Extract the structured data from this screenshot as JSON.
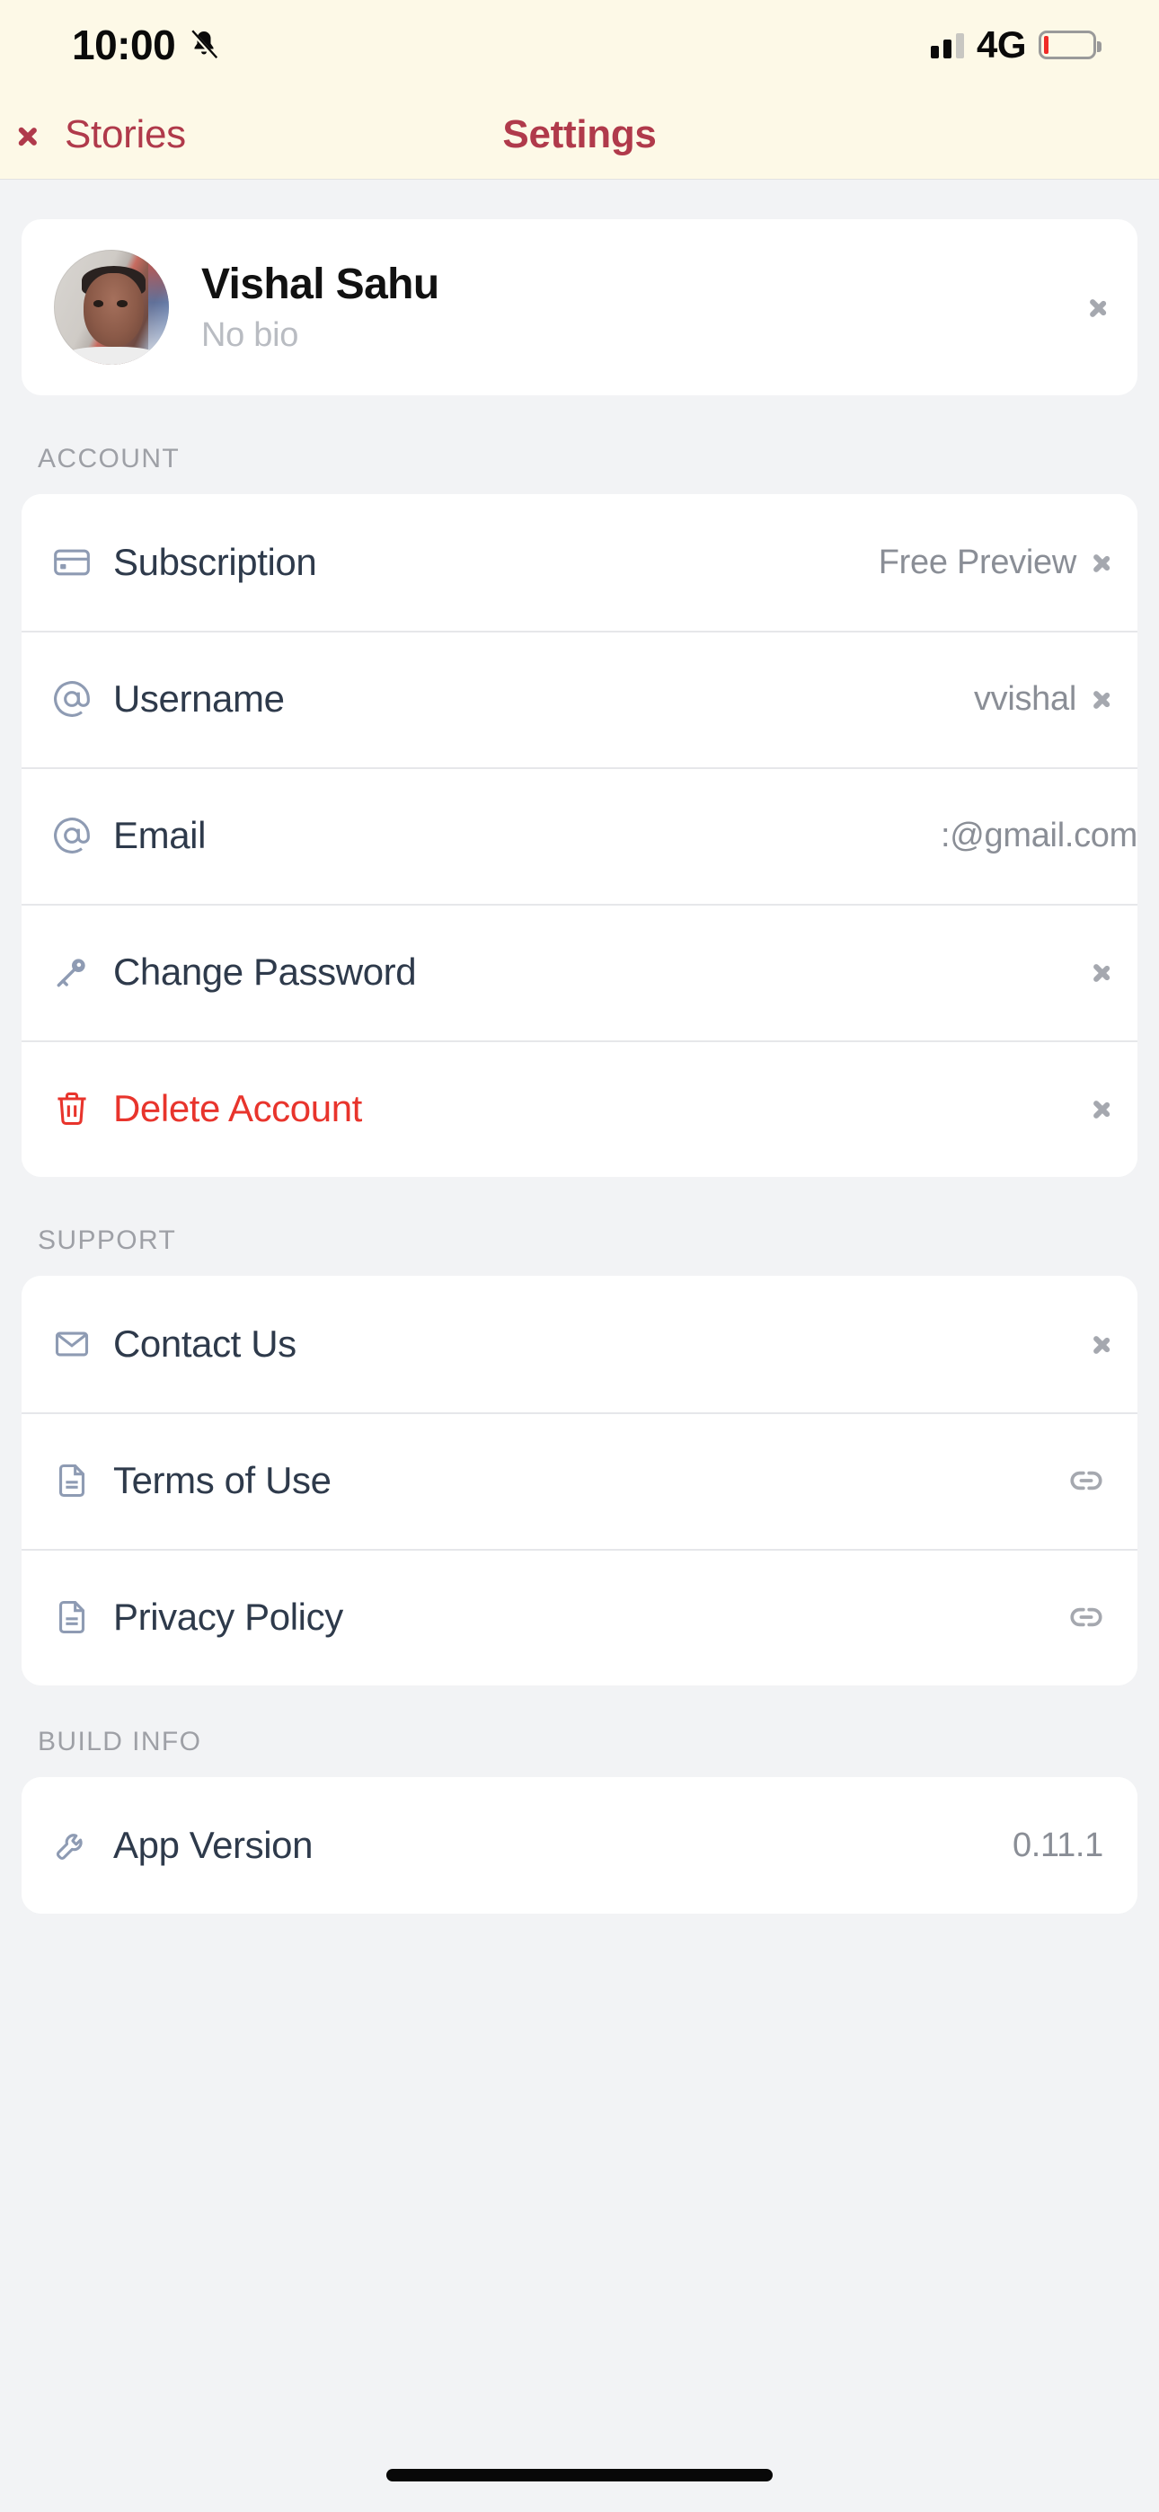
{
  "status_bar": {
    "time": "10:00",
    "silent_icon": "bell-slash-icon",
    "network": "4G",
    "signal_bars": 2,
    "battery_level_percent": 8
  },
  "nav": {
    "back_label": "Stories",
    "title": "Settings",
    "accent_color": "#B03A4B",
    "background_color": "#FDF9E7"
  },
  "profile": {
    "name": "Vishal Sahu",
    "bio": "No bio",
    "avatar_icon": "user-avatar-photo",
    "chevron_icon": "chevron-right-icon"
  },
  "sections": [
    {
      "label": "ACCOUNT",
      "rows": [
        {
          "icon": "credit-card-icon",
          "label": "Subscription",
          "value": "Free Preview",
          "trailing": "chevron-right-icon",
          "danger": false
        },
        {
          "icon": "at-sign-icon",
          "label": "Username",
          "value": "vvishal",
          "trailing": "chevron-right-icon",
          "danger": false
        },
        {
          "icon": "at-sign-icon",
          "label": "Email",
          "value": ":@gmail.com",
          "trailing": "none",
          "danger": false
        },
        {
          "icon": "key-icon",
          "label": "Change Password",
          "value": "",
          "trailing": "chevron-right-icon",
          "danger": false
        },
        {
          "icon": "trash-icon",
          "label": "Delete Account",
          "value": "",
          "trailing": "chevron-right-icon",
          "danger": true
        }
      ]
    },
    {
      "label": "SUPPORT",
      "rows": [
        {
          "icon": "mail-icon",
          "label": "Contact Us",
          "value": "",
          "trailing": "chevron-right-icon",
          "danger": false
        },
        {
          "icon": "document-icon",
          "label": "Terms of Use",
          "value": "",
          "trailing": "link-icon",
          "danger": false
        },
        {
          "icon": "document-icon",
          "label": "Privacy Policy",
          "value": "",
          "trailing": "link-icon",
          "danger": false
        }
      ]
    },
    {
      "label": "BUILD INFO",
      "rows": [
        {
          "icon": "wrench-icon",
          "label": "App Version",
          "value": "0.11.1",
          "trailing": "none",
          "danger": false
        }
      ]
    }
  ],
  "colors": {
    "page_background": "#F2F3F5",
    "card_background": "#FFFFFF",
    "label_text": "#2E3A4B",
    "value_text": "#8A8E96",
    "section_header": "#9EA0A6",
    "danger": "#E8342C",
    "icon_blue_gray": "#8E9BB3"
  },
  "home_indicator": "home-indicator"
}
